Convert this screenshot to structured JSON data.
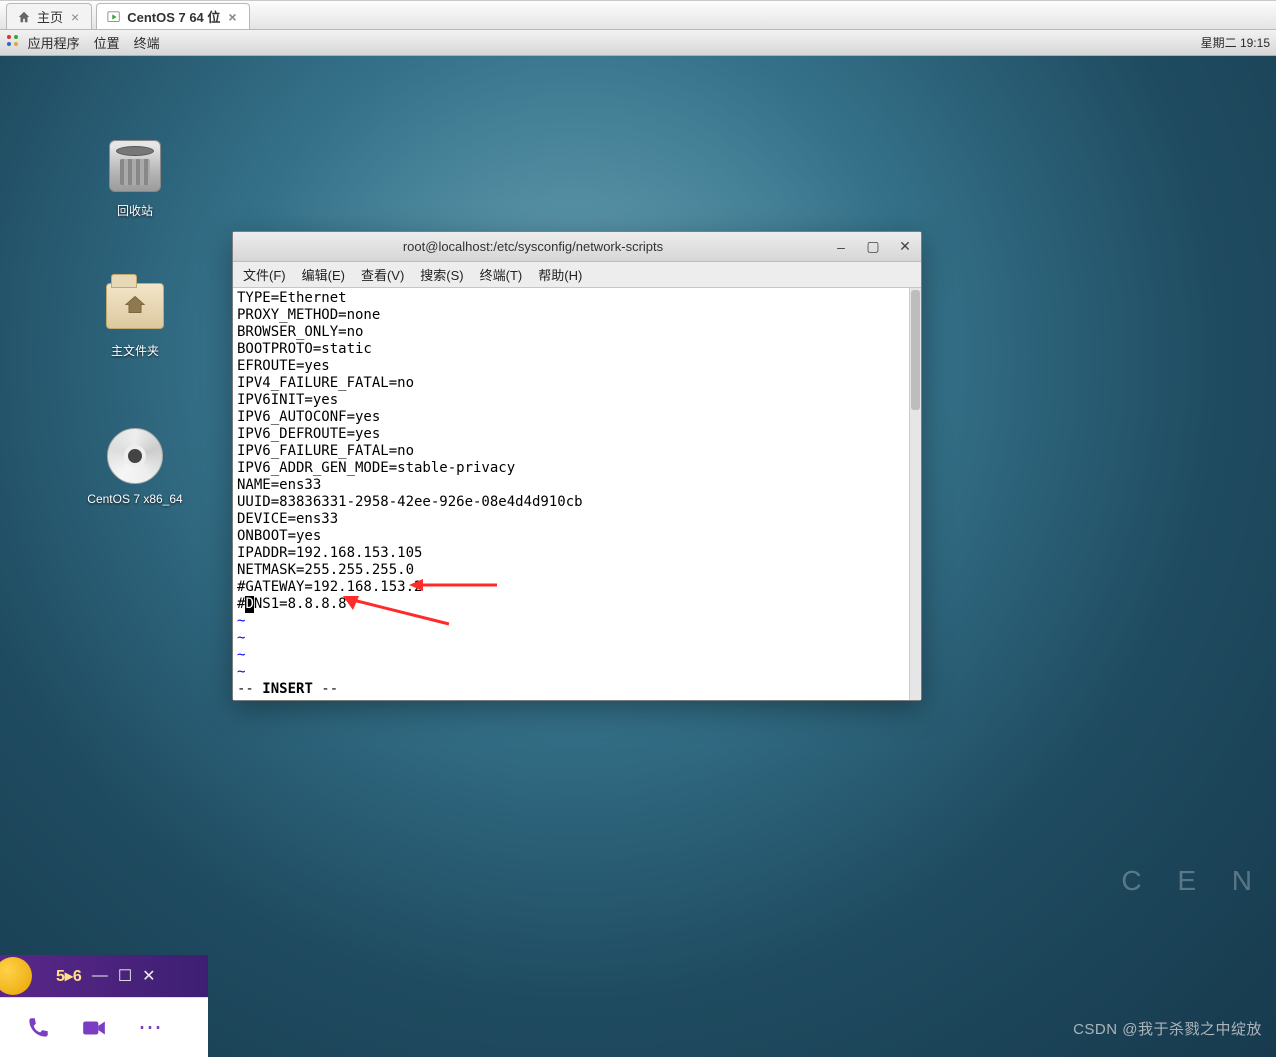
{
  "tabs": {
    "home": "主页",
    "vm": "CentOS 7 64 位"
  },
  "gnome": {
    "applications": "应用程序",
    "places": "位置",
    "terminal": "终端",
    "clock": "星期二 19:15"
  },
  "desktop_icons": {
    "trash": "回收站",
    "home": "主文件夹",
    "cd": "CentOS 7 x86_64"
  },
  "terminal": {
    "title": "root@localhost:/etc/sysconfig/network-scripts",
    "menu": {
      "file": "文件(F)",
      "edit": "编辑(E)",
      "view": "查看(V)",
      "search": "搜索(S)",
      "terminal": "终端(T)",
      "help": "帮助(H)"
    },
    "content": [
      "TYPE=Ethernet",
      "PROXY_METHOD=none",
      "BROWSER_ONLY=no",
      "BOOTPROTO=static",
      "EFROUTE=yes",
      "IPV4_FAILURE_FATAL=no",
      "IPV6INIT=yes",
      "IPV6_AUTOCONF=yes",
      "IPV6_DEFROUTE=yes",
      "IPV6_FAILURE_FATAL=no",
      "IPV6_ADDR_GEN_MODE=stable-privacy",
      "NAME=ens33",
      "UUID=83836331-2958-42ee-926e-08e4d4d910cb",
      "DEVICE=ens33",
      "ONBOOT=yes",
      "IPADDR=192.168.153.105",
      "NETMASK=255.255.255.0",
      "#GATEWAY=192.168.153.2"
    ],
    "dns_prefix": "#",
    "dns_cursor": "D",
    "dns_suffix": "NS1=8.8.8.8",
    "tilde": "~",
    "mode_prefix": "-- ",
    "mode": "INSERT",
    "mode_suffix": " --"
  },
  "bottom": {
    "num": "5▸6",
    "min": "—",
    "max": "☐",
    "close": "✕"
  },
  "watermark": "CSDN @我于杀戮之中绽放",
  "cen": "C E N"
}
